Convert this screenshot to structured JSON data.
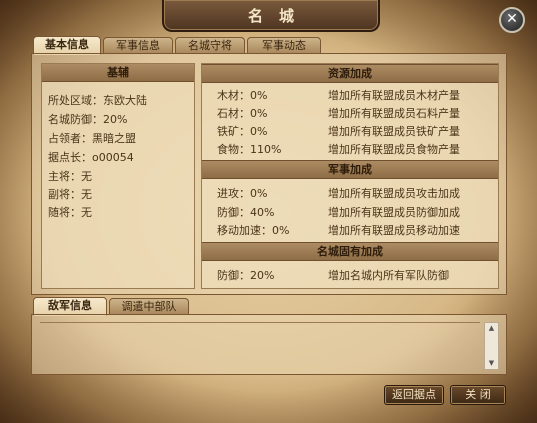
{
  "window": {
    "title": "名城",
    "close_symbol": "✕"
  },
  "tabs": [
    {
      "label": "基本信息",
      "active": true
    },
    {
      "label": "军事信息",
      "active": false
    },
    {
      "label": "名城守将",
      "active": false
    },
    {
      "label": "军事动态",
      "active": false
    }
  ],
  "base": {
    "header": "基辅",
    "rows": [
      "所处区域：东欧大陆",
      "名城防御：20%",
      "占领者：黑暗之盟",
      "据点长：o00054",
      "主将：无",
      "副将：无",
      "随将：无"
    ]
  },
  "bonus": {
    "resource": {
      "header": "资源加成",
      "rows": [
        {
          "key": "木材：0%",
          "desc": "增加所有联盟成员木材产量"
        },
        {
          "key": "石材：0%",
          "desc": "增加所有联盟成员石料产量"
        },
        {
          "key": "铁矿：0%",
          "desc": "增加所有联盟成员铁矿产量"
        },
        {
          "key": "食物：110%",
          "desc": "增加所有联盟成员食物产量"
        }
      ]
    },
    "military": {
      "header": "军事加成",
      "rows": [
        {
          "key": "进攻：0%",
          "desc": "增加所有联盟成员攻击加成"
        },
        {
          "key": "防御：40%",
          "desc": "增加所有联盟成员防御加成"
        },
        {
          "key": "移动加速：0%",
          "desc": "增加所有联盟成员移动加速"
        }
      ]
    },
    "inherent": {
      "header": "名城固有加成",
      "rows": [
        {
          "key": "防御：20%",
          "desc": "增加名城内所有军队防御"
        }
      ]
    }
  },
  "bottom_tabs": [
    {
      "label": "敌军信息",
      "active": true
    },
    {
      "label": "调遣中部队",
      "active": false
    }
  ],
  "scrollbar": {
    "up": "▲",
    "down": "▼"
  },
  "buttons": {
    "return": "返回据点",
    "close": "关 闭"
  }
}
